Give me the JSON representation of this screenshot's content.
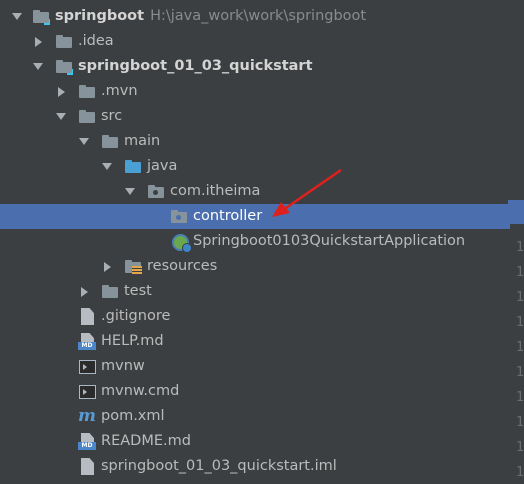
{
  "project": {
    "name": "springboot",
    "path": "H:\\java_work\\work\\springboot"
  },
  "tree": {
    "idea": ".idea",
    "module": "springboot_01_03_quickstart",
    "mvn": ".mvn",
    "src": "src",
    "main": "main",
    "java": "java",
    "package": "com.itheima",
    "controller": "controller",
    "app_class": "Springboot0103QuickstartApplication",
    "resources": "resources",
    "test": "test",
    "gitignore": ".gitignore",
    "help_md": "HELP.md",
    "mvnw": "mvnw",
    "mvnw_cmd": "mvnw.cmd",
    "pom": "pom.xml",
    "readme": "README.md",
    "iml": "springboot_01_03_quickstart.iml"
  },
  "icons": {
    "md_badge": "MD",
    "maven": "m"
  },
  "gutter": {
    "digit": "1"
  },
  "colors": {
    "background": "#3c3f41",
    "selection": "#4b6eaf",
    "annotation_arrow": "#e0201c"
  }
}
